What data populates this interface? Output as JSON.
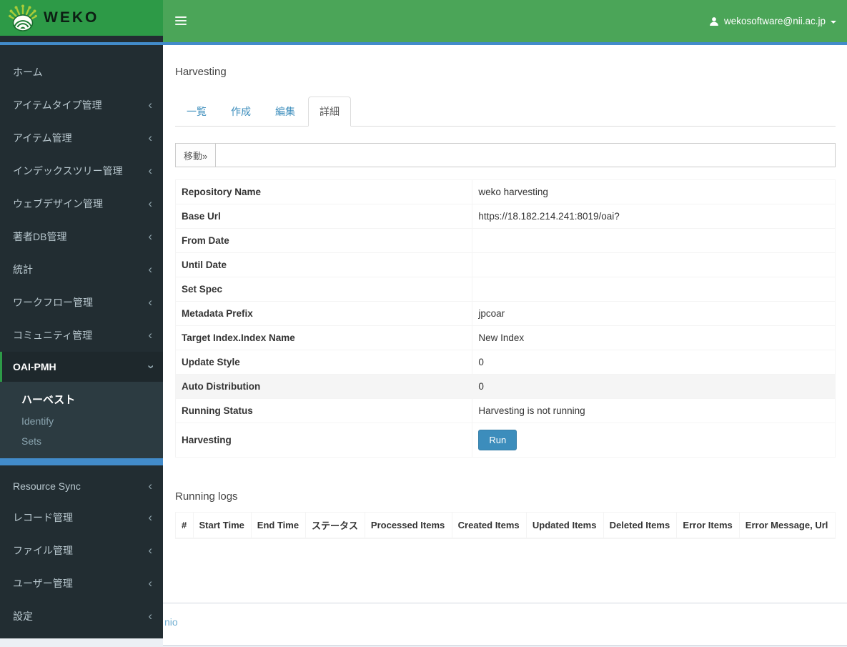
{
  "colors": {
    "logo_green": "#2d9a47",
    "navbar_green": "#4ba558",
    "accent_blue": "#428bca",
    "sidebar_dark": "#222d32",
    "sidebar_submenu_dark": "#2c3b41",
    "link_blue": "#3c8dbc",
    "run_button_blue": "#3c8dbc"
  },
  "header": {
    "logo_text": "WEKO",
    "user_email": "wekosoftware@nii.ac.jp"
  },
  "sidebar": {
    "items_top": [
      "ホーム",
      "アイテムタイプ管理",
      "アイテム管理",
      "インデックスツリー管理",
      "ウェブデザイン管理",
      "著者DB管理",
      "統計",
      "ワークフロー管理",
      "コミュニティ管理",
      "OAI-PMH"
    ],
    "submenu": [
      "ハーベスト",
      "Identify",
      "Sets"
    ],
    "items_bottom": [
      "Resource Sync",
      "レコード管理",
      "ファイル管理",
      "ユーザー管理",
      "設定"
    ]
  },
  "main": {
    "title": "Harvesting",
    "tabs": [
      "一覧",
      "作成",
      "編集",
      "詳細"
    ],
    "move_label": "移動»",
    "details": [
      {
        "label": "Repository Name",
        "value": "weko harvesting"
      },
      {
        "label": "Base Url",
        "value": "https://18.182.214.241:8019/oai?"
      },
      {
        "label": "From Date",
        "value": ""
      },
      {
        "label": "Until Date",
        "value": ""
      },
      {
        "label": "Set Spec",
        "value": ""
      },
      {
        "label": "Metadata Prefix",
        "value": "jpcoar"
      },
      {
        "label": "Target Index.Index Name",
        "value": "New Index"
      },
      {
        "label": "Update Style",
        "value": "0"
      },
      {
        "label": "Auto Distribution",
        "value": "0"
      },
      {
        "label": "Running Status",
        "value": "Harvesting is not running"
      },
      {
        "label": "Harvesting",
        "value": ""
      }
    ],
    "run_label": "Run",
    "logs_title": "Running logs",
    "logs_columns": [
      "#",
      "Start Time",
      "End Time",
      "ステータス",
      "Processed Items",
      "Created Items",
      "Updated Items",
      "Deleted Items",
      "Error Items",
      "Error Message, Url"
    ]
  },
  "footer": {
    "link_text": "nio"
  }
}
